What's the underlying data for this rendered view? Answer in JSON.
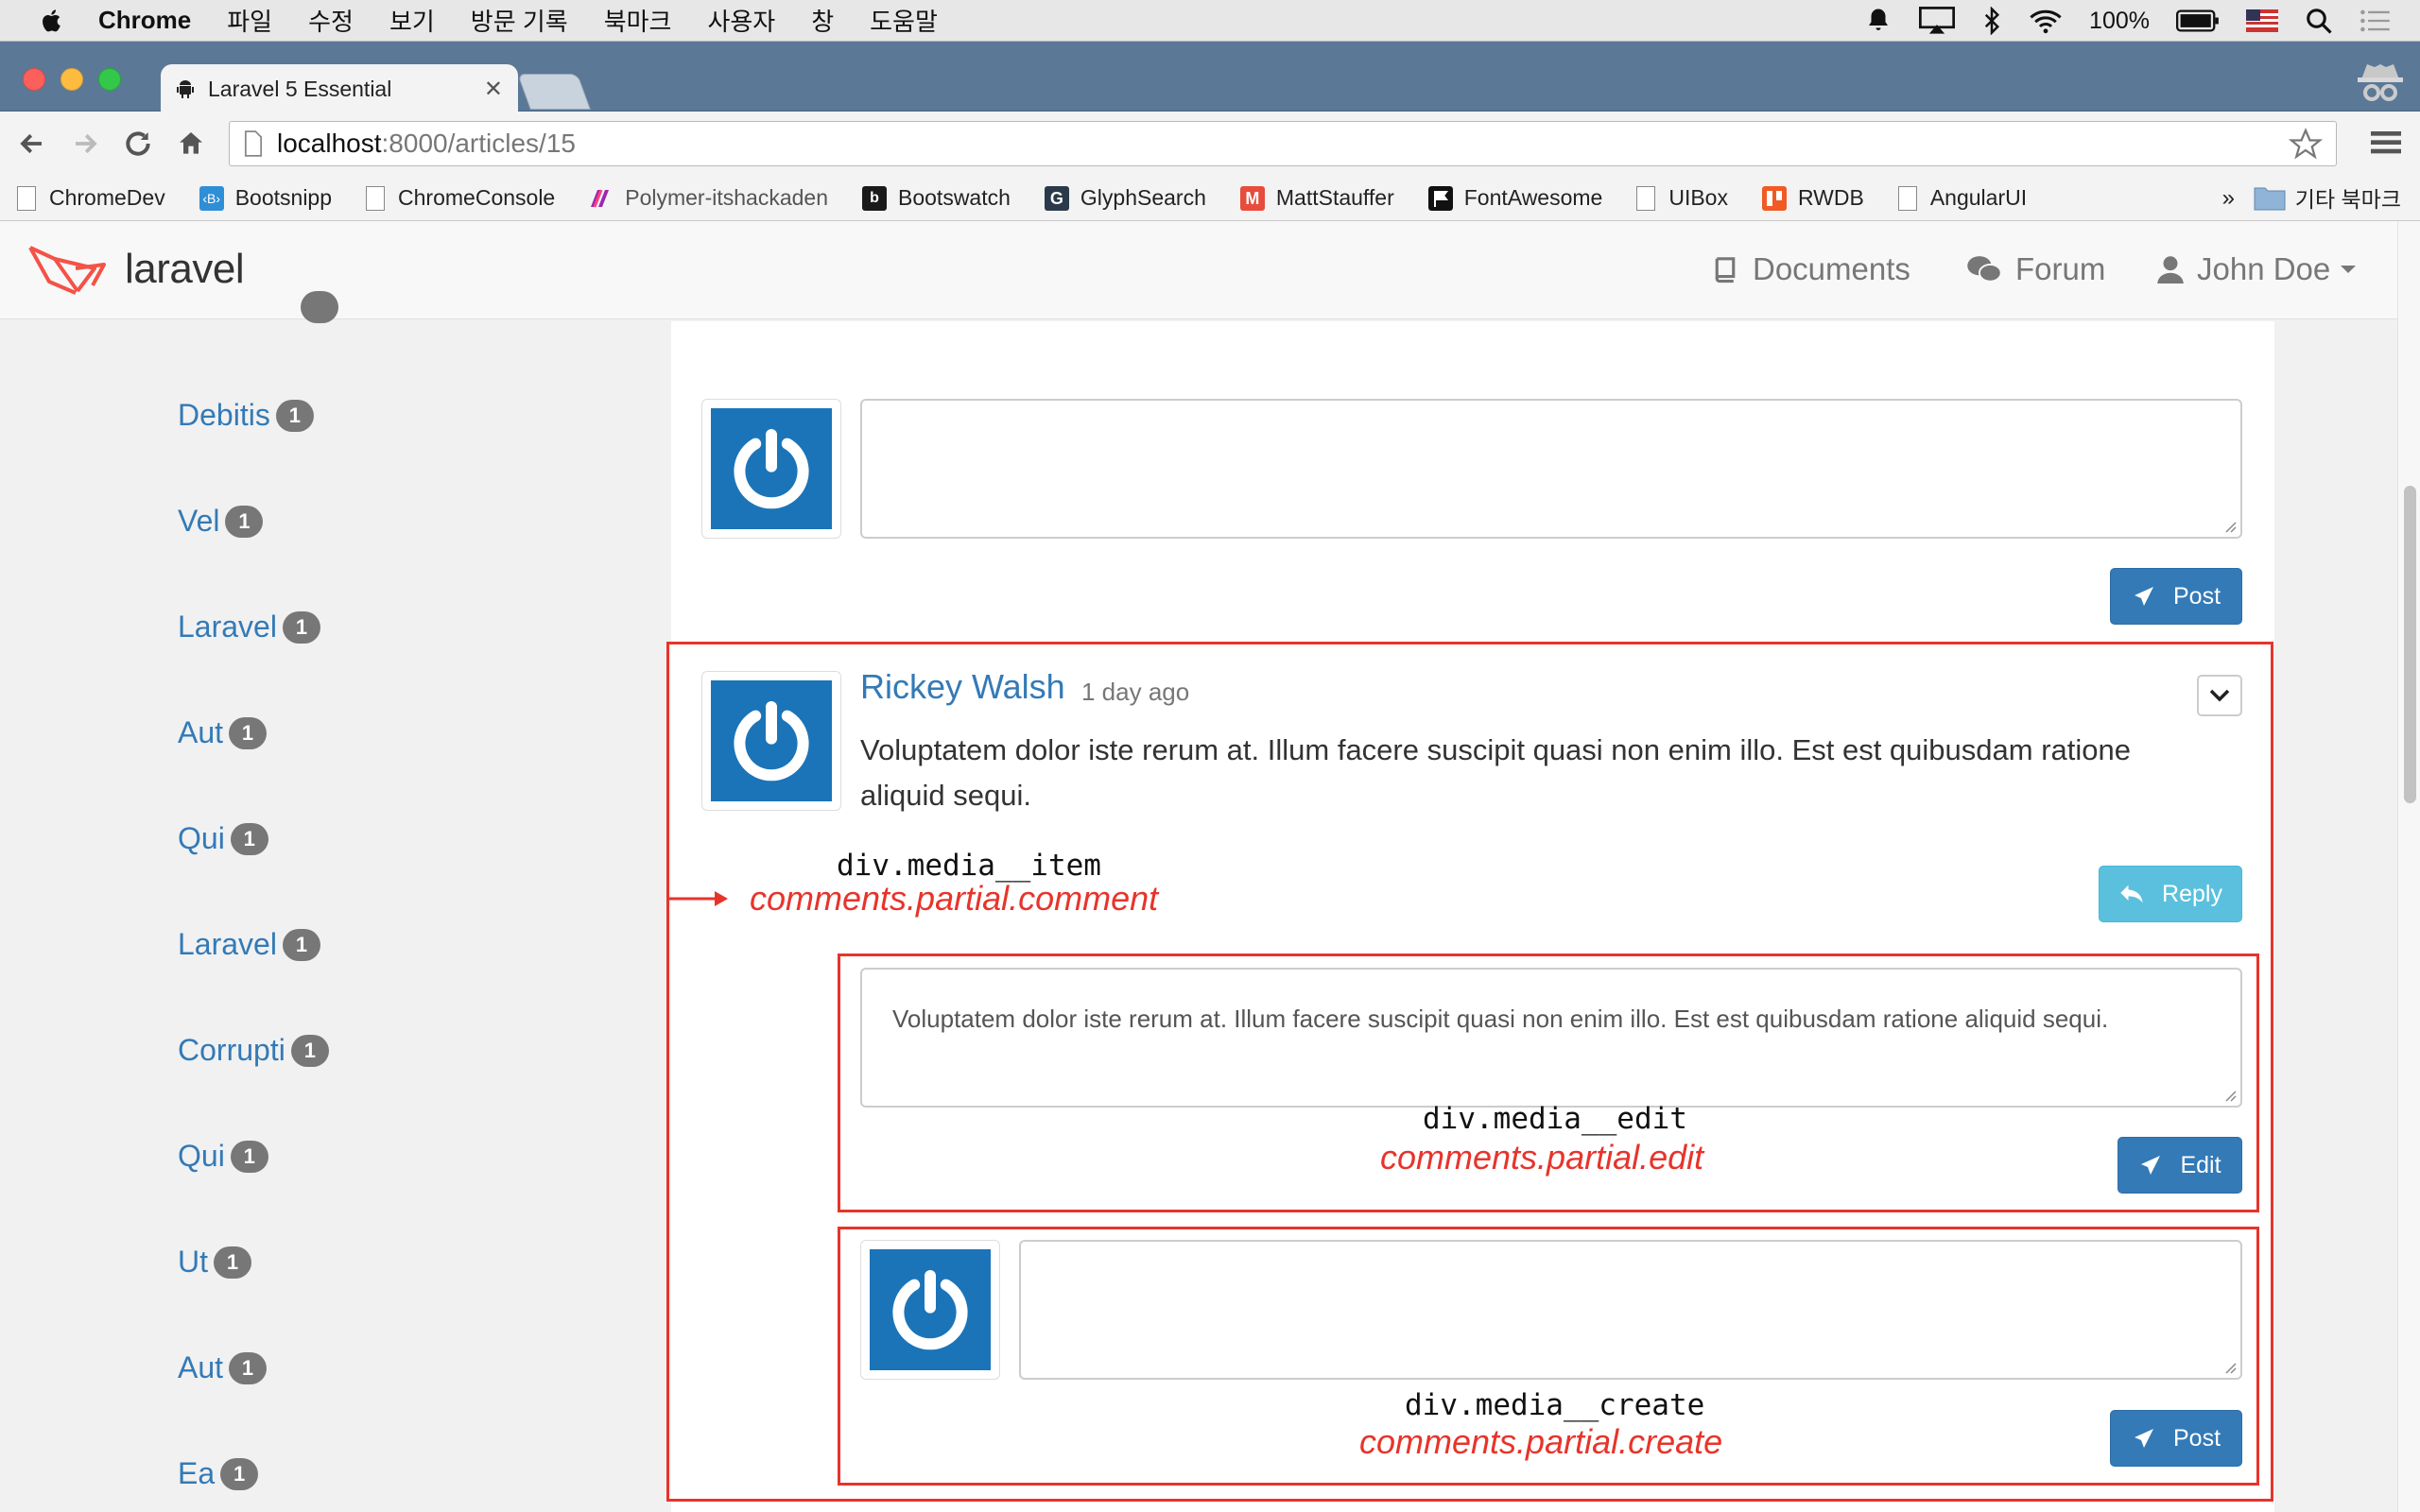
{
  "menubar": {
    "app": "Chrome",
    "items": [
      "파일",
      "수정",
      "보기",
      "방문 기록",
      "북마크",
      "사용자",
      "창",
      "도움말"
    ],
    "battery": "100%"
  },
  "tab": {
    "title": "Laravel 5 Essential"
  },
  "address": {
    "host": "localhost",
    "path": ":8000/articles/15"
  },
  "bookmarks": [
    {
      "label": "ChromeDev",
      "icon": "page-icon"
    },
    {
      "label": "Bootsnipp",
      "icon": "bootsnipp-icon"
    },
    {
      "label": "ChromeConsole",
      "icon": "page-icon"
    },
    {
      "label": "Polymer-itshackaden",
      "icon": "polymer-icon"
    },
    {
      "label": "Bootswatch",
      "icon": "bootswatch-icon"
    },
    {
      "label": "GlyphSearch",
      "icon": "glyphsearch-icon"
    },
    {
      "label": "MattStauffer",
      "icon": "m-icon"
    },
    {
      "label": "FontAwesome",
      "icon": "flag-icon"
    },
    {
      "label": "UIBox",
      "icon": "page-icon"
    },
    {
      "label": "RWDB",
      "icon": "rwdb-icon"
    },
    {
      "label": "AngularUI",
      "icon": "page-icon"
    }
  ],
  "bookmarks_more": "»",
  "bookmarks_other": "기타 북마크",
  "site": {
    "logo": "laravel",
    "nav": {
      "documents": "Documents",
      "forum": "Forum",
      "user": "John Doe"
    }
  },
  "tags": [
    {
      "name": "Debitis",
      "count": "1"
    },
    {
      "name": "Vel",
      "count": "1"
    },
    {
      "name": "Laravel",
      "count": "1"
    },
    {
      "name": "Aut",
      "count": "1"
    },
    {
      "name": "Qui",
      "count": "1"
    },
    {
      "name": "Laravel",
      "count": "1"
    },
    {
      "name": "Corrupti",
      "count": "1"
    },
    {
      "name": "Qui",
      "count": "1"
    },
    {
      "name": "Ut",
      "count": "1"
    },
    {
      "name": "Aut",
      "count": "1"
    },
    {
      "name": "Ea",
      "count": "1"
    }
  ],
  "top_form": {
    "post_label": "Post"
  },
  "comment": {
    "author": "Rickey Walsh",
    "time": "1 day ago",
    "body": "Voluptatem dolor iste rerum at. Illum facere suscipit quasi non enim illo. Est est quibusdam ratione aliquid sequi.",
    "reply_label": "Reply"
  },
  "edit_form": {
    "text": "Voluptatem dolor iste rerum at. Illum facere suscipit quasi non enim illo. Est est quibusdam ratione aliquid sequi.",
    "edit_label": "Edit"
  },
  "create_form": {
    "post_label": "Post"
  },
  "annotations": {
    "item_class": "div.media__item",
    "item_partial": "comments.partial.comment",
    "edit_class": "div.media__edit",
    "edit_partial": "comments.partial.edit",
    "create_class": "div.media__create",
    "create_partial": "comments.partial.create"
  },
  "colors": {
    "link": "#337ab7",
    "primary": "#337ab7",
    "info": "#5bc0de",
    "annotation": "#e7342b",
    "avatar": "#1b74b8"
  }
}
